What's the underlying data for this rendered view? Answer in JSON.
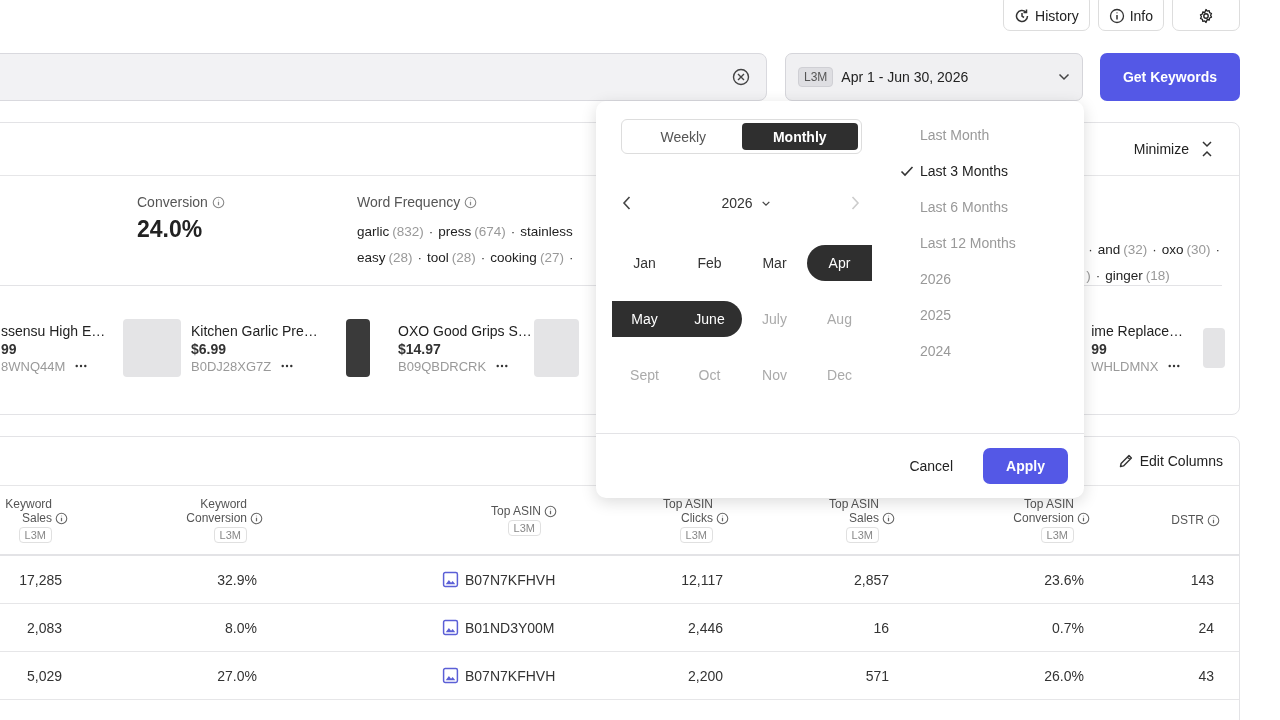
{
  "toolbar": {
    "buttons": [
      {
        "kind": "history",
        "label": "History"
      },
      {
        "kind": "info",
        "label": "Info"
      },
      {
        "kind": "settings"
      }
    ]
  },
  "search": {
    "date_range": {
      "badge": "L3M",
      "value": "Apr 1 - Jun 30, 2026"
    },
    "submit": "Get Keywords"
  },
  "summary": {
    "minimize": "Minimize",
    "conversion": {
      "label": "Conversion",
      "value": "24.0%"
    },
    "word_frequency": {
      "label": "Word Frequency",
      "rows_left": [
        [
          {
            "word": "garlic",
            "count": "(832)",
            "sep": "·"
          },
          {
            "word": "press",
            "count": "(674)",
            "sep": "·"
          },
          {
            "word": "stainless"
          }
        ],
        [
          {
            "word": "easy",
            "count": "(28)",
            "sep": "·"
          },
          {
            "word": "tool",
            "count": "(28)",
            "sep": "·"
          },
          {
            "word": "cooking",
            "count": "(27)",
            "sep": "·"
          }
        ]
      ],
      "rows_right": [
        [
          {
            "lead": "·",
            "word": "and",
            "count": "(32)",
            "sep": "·"
          },
          {
            "word": "oxo",
            "count": "(30)",
            "sep": "·"
          }
        ],
        [
          {
            "count": ")",
            "sep": "·"
          },
          {
            "word": "ginger",
            "count": "(18)"
          }
        ]
      ]
    },
    "products_left": [
      {
        "kind": "text",
        "name": "ssensu High E…",
        "price": "99",
        "asin": "8WNQ44M"
      },
      {
        "kind": "full",
        "name": "Kitchen Garlic Pre…",
        "price": "$6.99",
        "asin": "B0DJ28XG7Z"
      },
      {
        "kind": "full",
        "name": "OXO Good Grips S…",
        "price": "$14.97",
        "asin": "B09QBDRCRK"
      },
      {
        "kind": "image"
      }
    ],
    "products_right": [
      {
        "kind": "text",
        "name": "ime Replace…",
        "price": "99",
        "asin": "WHLDMNX"
      },
      {
        "kind": "image"
      }
    ]
  },
  "table": {
    "edit_columns": "Edit Columns",
    "columns": [
      {
        "kind": "number",
        "label": [
          "Keyword",
          "Sales"
        ],
        "badge": "L3M"
      },
      {
        "kind": "number",
        "label": [
          "Keyword",
          "Conversion"
        ],
        "badge": "L3M"
      },
      {
        "kind": "asin",
        "label": [
          "Top ASIN"
        ],
        "badge": "L3M"
      },
      {
        "kind": "number",
        "label": [
          "Top ASIN",
          "Clicks"
        ],
        "badge": "L3M"
      },
      {
        "kind": "number",
        "label": [
          "Top ASIN",
          "Sales"
        ],
        "badge": "L3M"
      },
      {
        "kind": "number",
        "label": [
          "Top ASIN",
          "Conversion"
        ],
        "badge": "L3M"
      },
      {
        "kind": "number",
        "label": [
          "DSTR"
        ]
      }
    ],
    "rows": [
      [
        "17,285",
        "32.9%",
        "B07N7KFHVH",
        "12,117",
        "2,857",
        "23.6%",
        "143"
      ],
      [
        "2,083",
        "8.0%",
        "B01ND3Y00M",
        "2,446",
        "16",
        "0.7%",
        "24"
      ],
      [
        "5,029",
        "27.0%",
        "B07N7KFHVH",
        "2,200",
        "571",
        "26.0%",
        "43"
      ]
    ]
  },
  "date_picker": {
    "modes": [
      {
        "label": "Weekly",
        "selected": false
      },
      {
        "label": "Monthly",
        "selected": true
      }
    ],
    "year": "2026",
    "prev_disabled": false,
    "next_disabled": true,
    "months": [
      {
        "label": "Jan",
        "selected": false,
        "disabled": false
      },
      {
        "label": "Feb",
        "selected": false,
        "disabled": false
      },
      {
        "label": "Mar",
        "selected": false,
        "disabled": false
      },
      {
        "label": "Apr",
        "selected": true,
        "disabled": false
      },
      {
        "label": "May",
        "selected": true,
        "disabled": false
      },
      {
        "label": "June",
        "selected": true,
        "disabled": false
      },
      {
        "label": "July",
        "selected": false,
        "disabled": true
      },
      {
        "label": "Aug",
        "selected": false,
        "disabled": true
      },
      {
        "label": "Sept",
        "selected": false,
        "disabled": true
      },
      {
        "label": "Oct",
        "selected": false,
        "disabled": true
      },
      {
        "label": "Nov",
        "selected": false,
        "disabled": true
      },
      {
        "label": "Dec",
        "selected": false,
        "disabled": true
      }
    ],
    "presets": [
      {
        "label": "Last Month",
        "selected": false
      },
      {
        "label": "Last 3 Months",
        "selected": true
      },
      {
        "label": "Last 6 Months",
        "selected": false
      },
      {
        "label": "Last 12 Months",
        "selected": false
      },
      {
        "label": "2026",
        "selected": false
      },
      {
        "label": "2025",
        "selected": false
      },
      {
        "label": "2024",
        "selected": false
      }
    ],
    "cancel": "Cancel",
    "apply": "Apply"
  }
}
